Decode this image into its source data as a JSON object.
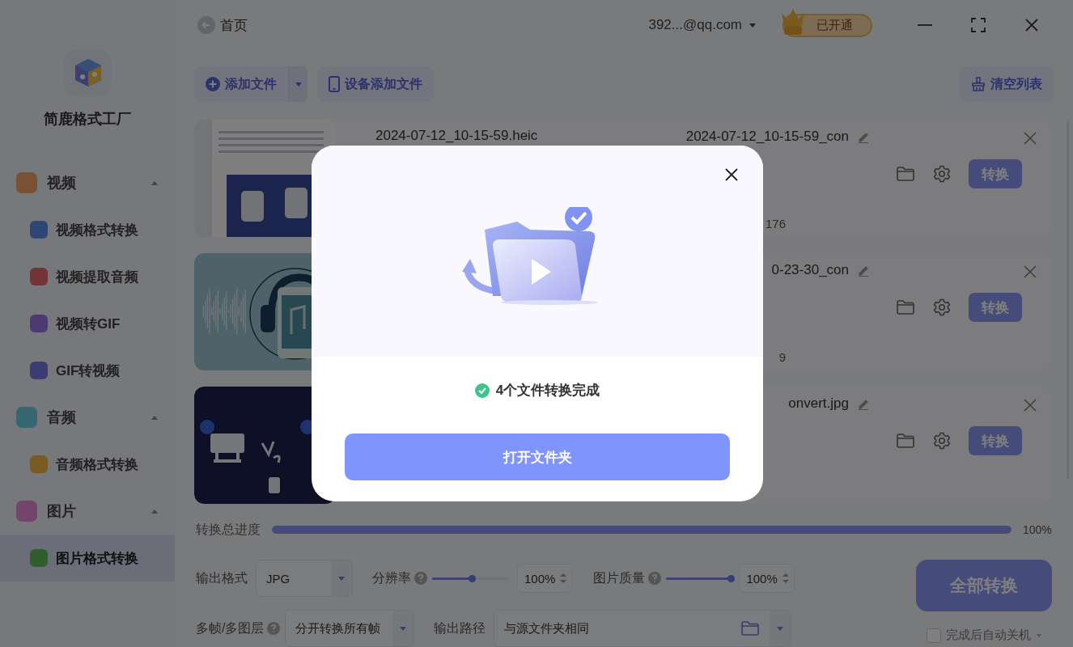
{
  "header": {
    "back_label": "首页",
    "account": "392...@qq.com",
    "vip_badge": "已开通"
  },
  "sidebar": {
    "app_name": "简鹿格式工厂",
    "groups": [
      {
        "label": "视频",
        "expanded": true,
        "items": [
          {
            "label": "视频格式转换",
            "selected": false
          },
          {
            "label": "视频提取音频",
            "selected": false
          },
          {
            "label": "视频转GIF",
            "selected": false
          },
          {
            "label": "GIF转视频",
            "selected": false
          }
        ]
      },
      {
        "label": "音频",
        "expanded": true,
        "items": [
          {
            "label": "音频格式转换",
            "selected": false
          }
        ]
      },
      {
        "label": "图片",
        "expanded": true,
        "items": [
          {
            "label": "图片格式转换",
            "selected": true
          }
        ]
      }
    ]
  },
  "toolbar": {
    "add_file": "添加文件",
    "device_add": "设备添加文件",
    "clear_list": "清空列表"
  },
  "files": [
    {
      "kind": "document",
      "source_name": "2024-07-12_10-15-59.heic",
      "output_name": "2024-07-12_10-15-59_con",
      "detail": "176",
      "convert": "转换"
    },
    {
      "kind": "headphones",
      "output_name": "0-23-30_con",
      "detail": "9",
      "convert": "转换"
    },
    {
      "kind": "dark",
      "output_name": "onvert.jpg",
      "convert": "转换"
    }
  ],
  "progress": {
    "label": "转换总进度",
    "level": 1,
    "reading": "100%"
  },
  "settings": {
    "output_format": {
      "label": "输出格式",
      "value": "JPG"
    },
    "resolution": {
      "label": "分辨率",
      "level": 0.52,
      "value": "100%"
    },
    "quality": {
      "label": "图片质量",
      "level": 1,
      "value": "100%"
    },
    "frames": {
      "label": "多帧/多图层",
      "value": "分开转换所有帧"
    },
    "output_path": {
      "label": "输出路径",
      "value": "与源文件夹相同"
    },
    "convert_all": "全部转换",
    "auto_shutdown": {
      "label": "完成后自动关机",
      "checked": false
    }
  },
  "dialog": {
    "message": "4个文件转换完成",
    "button": "打开文件夹"
  }
}
